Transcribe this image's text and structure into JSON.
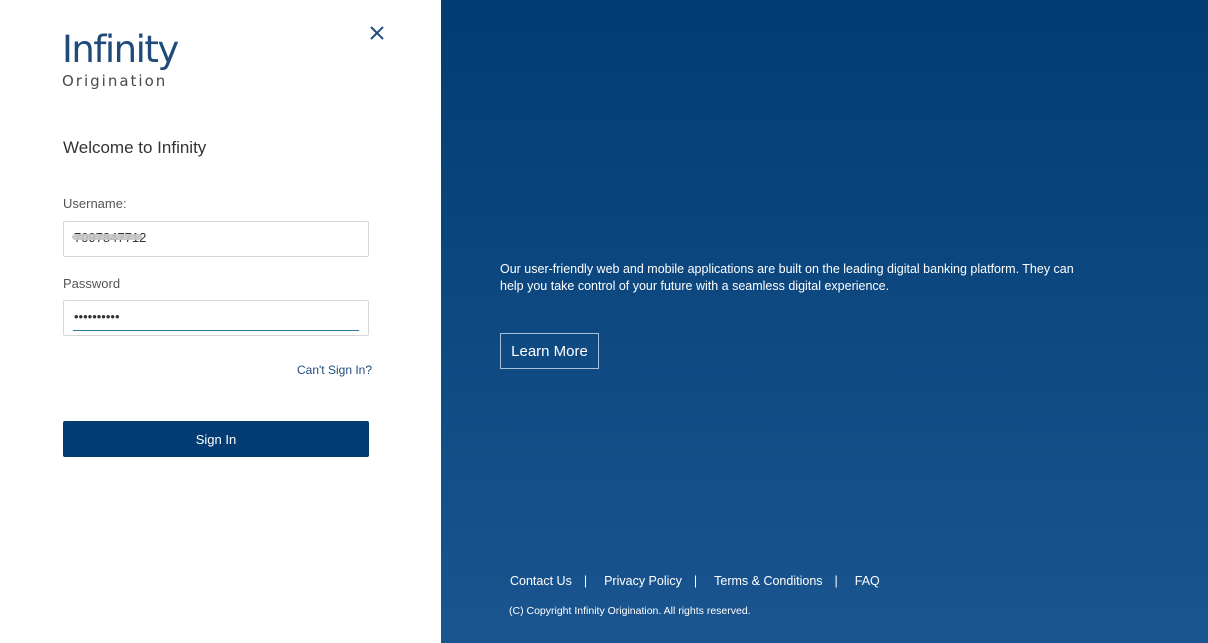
{
  "logo": {
    "main": "Infinity",
    "sub": "Origination"
  },
  "login": {
    "welcome": "Welcome to Infinity",
    "username_label": "Username:",
    "username_value": "7097847712",
    "password_label": "Password",
    "password_value": "••••••••••",
    "cant_sign_in": "Can't Sign In?",
    "sign_in": "Sign In"
  },
  "promo": {
    "tagline": "Our user-friendly web and mobile applications are built on the leading digital banking platform. They can help you take control of your future with a seamless digital experience.",
    "learn_more": "Learn More"
  },
  "footer": {
    "links": [
      "Contact Us",
      "Privacy Policy",
      "Terms & Conditions",
      "FAQ"
    ],
    "separator": "|",
    "copyright": "(C) Copyright Infinity Origination. All rights reserved."
  },
  "colors": {
    "primary": "#023c72",
    "logo": "#1f4a7a",
    "gradient_end": "#1b5590"
  },
  "icons": {
    "close": "close-icon"
  }
}
